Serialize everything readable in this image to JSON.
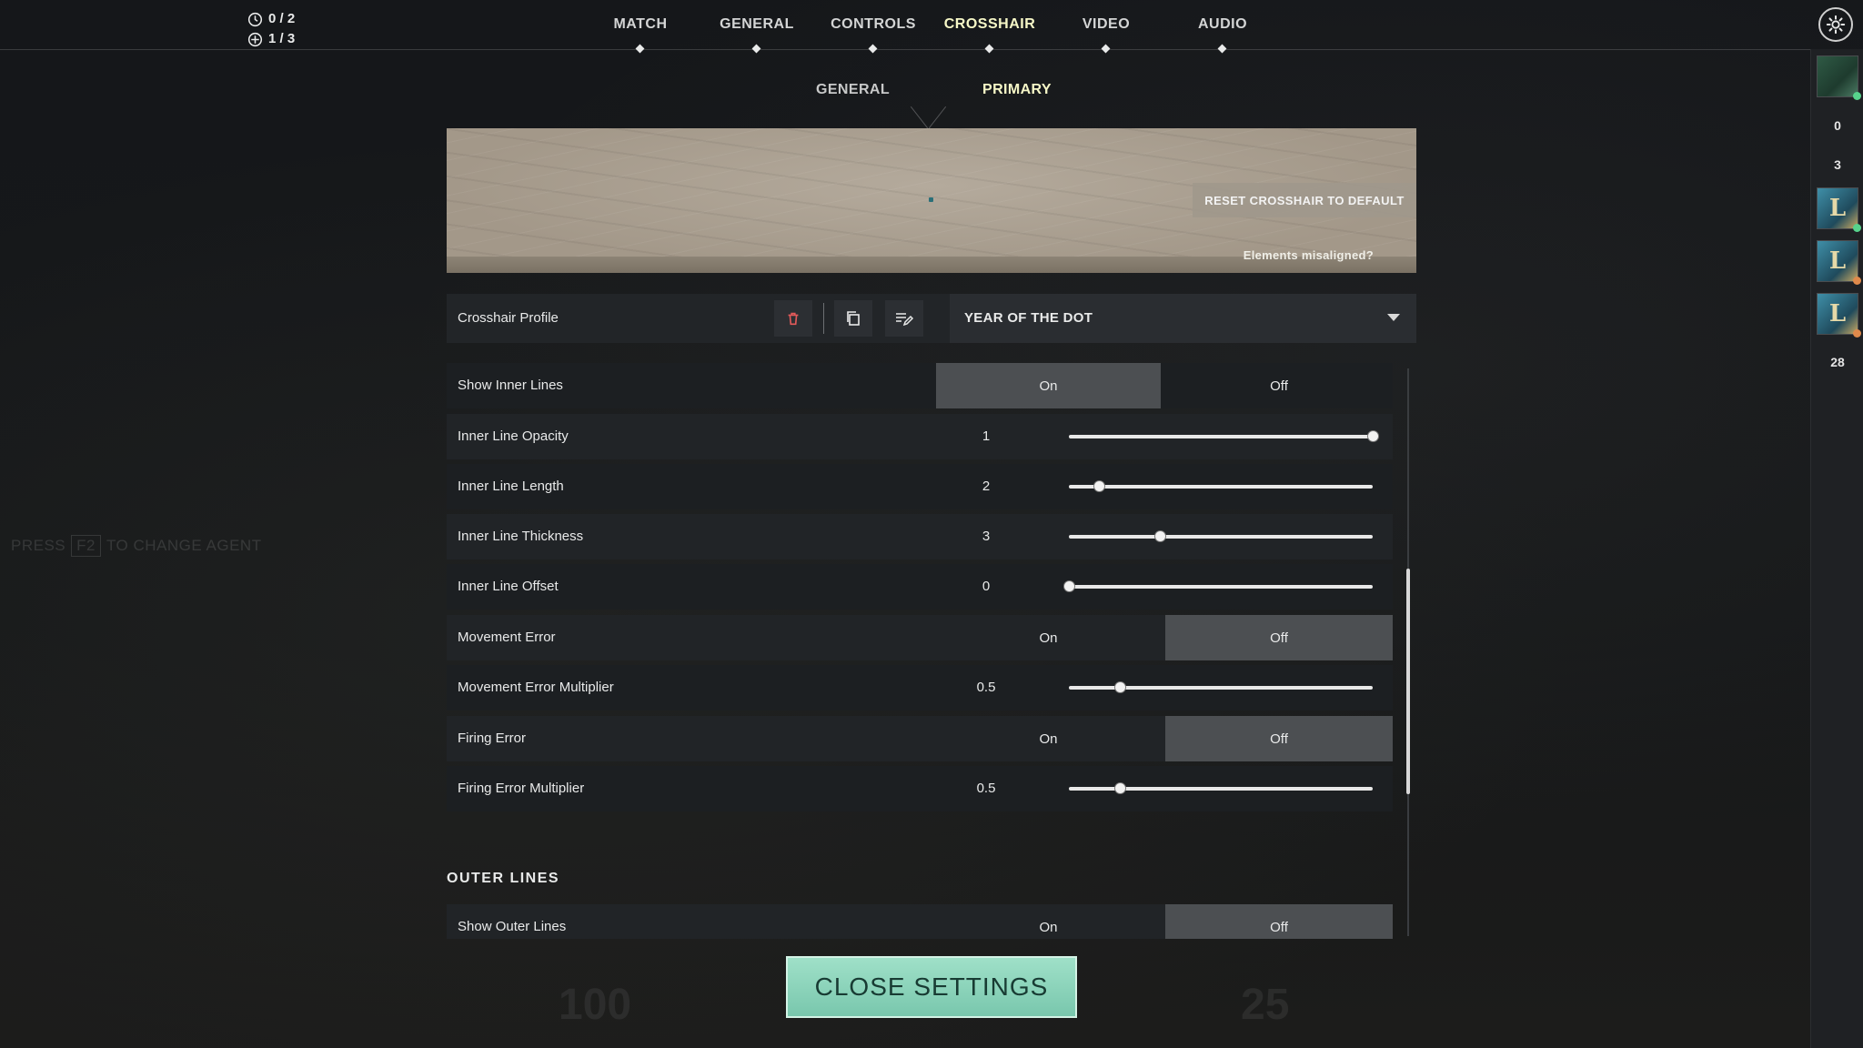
{
  "counters": {
    "timer": "0 / 2",
    "plus": "1 / 3"
  },
  "tabs": [
    {
      "label": "MATCH",
      "active": false
    },
    {
      "label": "GENERAL",
      "active": false
    },
    {
      "label": "CONTROLS",
      "active": false
    },
    {
      "label": "CROSSHAIR",
      "active": true
    },
    {
      "label": "VIDEO",
      "active": false
    },
    {
      "label": "AUDIO",
      "active": false
    }
  ],
  "subtabs": [
    {
      "label": "GENERAL",
      "active": false
    },
    {
      "label": "PRIMARY",
      "active": true
    }
  ],
  "preview": {
    "reset_label": "RESET CROSSHAIR TO DEFAULT",
    "misaligned_label": "Elements misaligned?"
  },
  "profile": {
    "label": "Crosshair Profile",
    "selected": "YEAR OF THE DOT",
    "icons": [
      "trash-icon",
      "copy-icon",
      "rename-icon"
    ]
  },
  "settings": [
    {
      "name": "Show Inner Lines",
      "type": "toggle",
      "on_label": "On",
      "off_label": "Off",
      "value": "On"
    },
    {
      "name": "Inner Line Opacity",
      "type": "slider",
      "value": "1",
      "fraction": 1.0
    },
    {
      "name": "Inner Line Length",
      "type": "slider",
      "value": "2",
      "fraction": 0.1
    },
    {
      "name": "Inner Line Thickness",
      "type": "slider",
      "value": "3",
      "fraction": 0.3
    },
    {
      "name": "Inner Line Offset",
      "type": "slider",
      "value": "0",
      "fraction": 0.0
    },
    {
      "name": "Movement Error",
      "type": "toggle",
      "on_label": "On",
      "off_label": "Off",
      "value": "Off"
    },
    {
      "name": "Movement Error Multiplier",
      "type": "slider",
      "value": "0.5",
      "fraction": 0.167
    },
    {
      "name": "Firing Error",
      "type": "toggle",
      "on_label": "On",
      "off_label": "Off",
      "value": "Off"
    },
    {
      "name": "Firing Error Multiplier",
      "type": "slider",
      "value": "0.5",
      "fraction": 0.167
    }
  ],
  "outer": {
    "title": "OUTER LINES",
    "settings": [
      {
        "name": "Show Outer Lines",
        "type": "toggle",
        "on_label": "On",
        "off_label": "Off",
        "value": "Off"
      }
    ]
  },
  "rail": {
    "num_a": "0",
    "num_b": "3",
    "num_c": "28"
  },
  "close_label": "CLOSE SETTINGS",
  "background_hud": {
    "hint_press": "PRESS",
    "hint_key": "F2",
    "hint_rest": "TO CHANGE AGENT",
    "health": "100",
    "ammo": "25"
  },
  "colors": {
    "active_tab": "#f6f7c7",
    "close_button": "#8fd8bd",
    "selected_option": "#4c4f52"
  }
}
